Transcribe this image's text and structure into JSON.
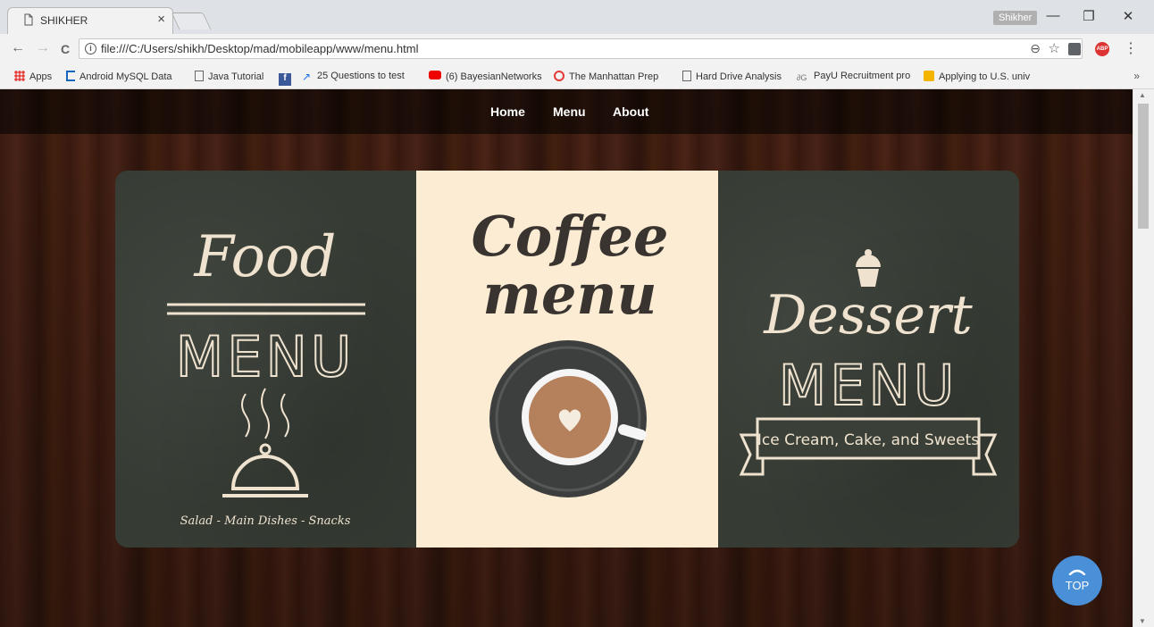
{
  "browser": {
    "tab_title": "SHIKHER",
    "tab_close": "×",
    "profile_name": "Shikher",
    "window_buttons": {
      "minimize": "—",
      "restore": "❐",
      "close": "✕"
    },
    "nav": {
      "back": "←",
      "forward": "→",
      "reload": "C"
    },
    "url": "file:///C:/Users/shikh/Desktop/mad/mobileapp/www/menu.html",
    "bookmarks": [
      {
        "label": "Apps"
      },
      {
        "label": "Android MySQL Data"
      },
      {
        "label": "Java Tutorial"
      },
      {
        "label": ""
      },
      {
        "label": "25 Questions to test"
      },
      {
        "label": "(6) BayesianNetworks"
      },
      {
        "label": "The Manhattan Prep"
      },
      {
        "label": "Hard Drive Analysis"
      },
      {
        "label": "PayU Recruitment pro"
      },
      {
        "label": "Applying to U.S. univ"
      }
    ],
    "bookmarks_more": "»"
  },
  "site": {
    "nav": {
      "home": "Home",
      "menu": "Menu",
      "about": "About"
    },
    "menus": {
      "food": {
        "script_title": "Food",
        "block_title": "MENU",
        "subtitle": "Salad - Main Dishes - Snacks"
      },
      "coffee": {
        "script_line1": "Coffee",
        "script_line2": "menu"
      },
      "dessert": {
        "script_title": "Dessert",
        "block_title": "MENU",
        "banner": "Ice Cream, Cake, and Sweets"
      }
    },
    "top_button": "TOP"
  },
  "colors": {
    "chalk_text": "#efe3cf",
    "coffee_text": "#3a3430",
    "top_button": "#4a90d9"
  }
}
